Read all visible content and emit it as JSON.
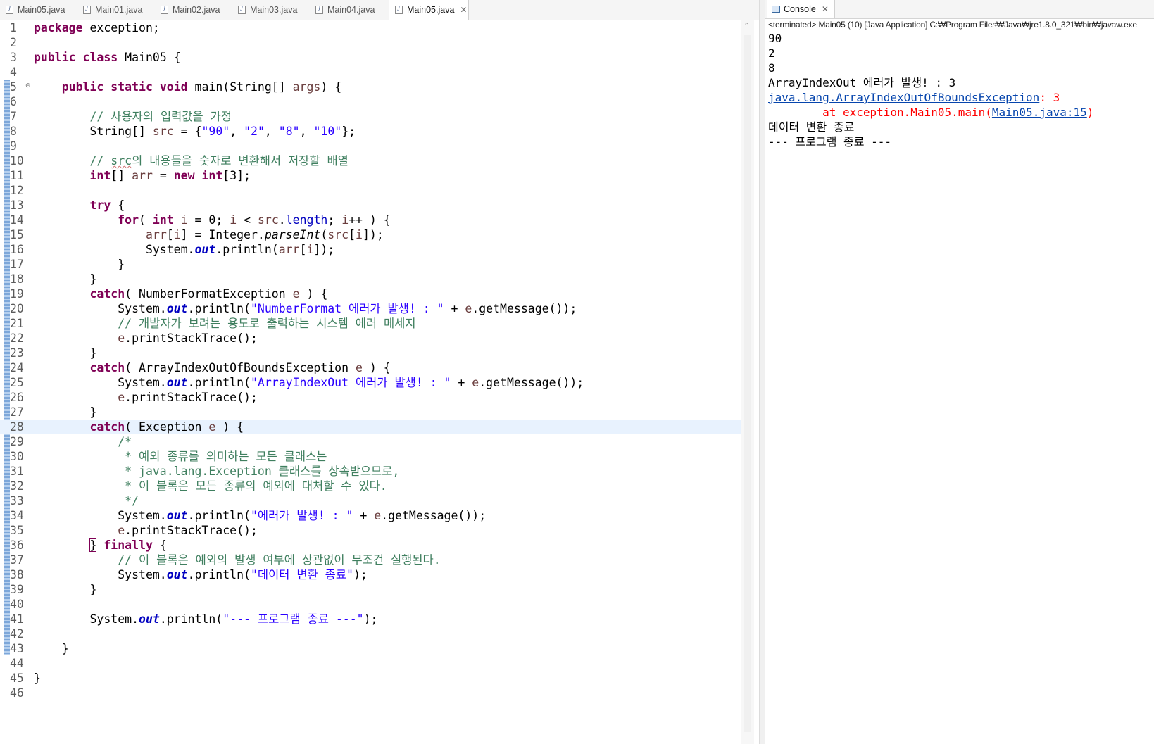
{
  "editor": {
    "tabs": [
      {
        "label": "Main05.java",
        "active": false
      },
      {
        "label": "Main01.java",
        "active": false
      },
      {
        "label": "Main02.java",
        "active": false
      },
      {
        "label": "Main03.java",
        "active": false
      },
      {
        "label": "Main04.java",
        "active": false
      },
      {
        "label": "Main05.java",
        "active": true
      }
    ],
    "close_icon": "close-icon",
    "current_line": 28,
    "lines": [
      [
        {
          "t": "package",
          "c": "kw"
        },
        {
          "t": " exception;"
        }
      ],
      [],
      [
        {
          "t": "public",
          "c": "kw"
        },
        {
          "t": " "
        },
        {
          "t": "class",
          "c": "kw"
        },
        {
          "t": " Main05 {"
        }
      ],
      [],
      [
        {
          "t": "    "
        },
        {
          "t": "public",
          "c": "kw"
        },
        {
          "t": " "
        },
        {
          "t": "static",
          "c": "kw"
        },
        {
          "t": " "
        },
        {
          "t": "void",
          "c": "kw"
        },
        {
          "t": " main(String[] "
        },
        {
          "t": "args",
          "c": "var"
        },
        {
          "t": ") {"
        }
      ],
      [],
      [
        {
          "t": "        "
        },
        {
          "t": "// 사용자의 입력값을 가정",
          "c": "cm"
        }
      ],
      [
        {
          "t": "        String[] "
        },
        {
          "t": "src",
          "c": "var"
        },
        {
          "t": " = {"
        },
        {
          "t": "\"90\"",
          "c": "str"
        },
        {
          "t": ", "
        },
        {
          "t": "\"2\"",
          "c": "str"
        },
        {
          "t": ", "
        },
        {
          "t": "\"8\"",
          "c": "str"
        },
        {
          "t": ", "
        },
        {
          "t": "\"10\"",
          "c": "str"
        },
        {
          "t": "};"
        }
      ],
      [],
      [
        {
          "t": "        "
        },
        {
          "t": "// ",
          "c": "cm"
        },
        {
          "t": "src",
          "c": "cm squig"
        },
        {
          "t": "의 내용들을 숫자로 변환해서 저장할 배열",
          "c": "cm"
        }
      ],
      [
        {
          "t": "        "
        },
        {
          "t": "int",
          "c": "kw"
        },
        {
          "t": "[] "
        },
        {
          "t": "arr",
          "c": "var"
        },
        {
          "t": " = "
        },
        {
          "t": "new",
          "c": "kw"
        },
        {
          "t": " "
        },
        {
          "t": "int",
          "c": "kw"
        },
        {
          "t": "[3];"
        }
      ],
      [],
      [
        {
          "t": "        "
        },
        {
          "t": "try",
          "c": "kw"
        },
        {
          "t": " {"
        }
      ],
      [
        {
          "t": "            "
        },
        {
          "t": "for",
          "c": "kw"
        },
        {
          "t": "( "
        },
        {
          "t": "int",
          "c": "kw"
        },
        {
          "t": " "
        },
        {
          "t": "i",
          "c": "var"
        },
        {
          "t": " = 0; "
        },
        {
          "t": "i",
          "c": "var"
        },
        {
          "t": " < "
        },
        {
          "t": "src",
          "c": "var"
        },
        {
          "t": "."
        },
        {
          "t": "length",
          "c": "fld"
        },
        {
          "t": "; "
        },
        {
          "t": "i",
          "c": "var"
        },
        {
          "t": "++ ) {"
        }
      ],
      [
        {
          "t": "                "
        },
        {
          "t": "arr",
          "c": "var"
        },
        {
          "t": "["
        },
        {
          "t": "i",
          "c": "var"
        },
        {
          "t": "] = Integer."
        },
        {
          "t": "parseInt",
          "c": "it"
        },
        {
          "t": "("
        },
        {
          "t": "src",
          "c": "var"
        },
        {
          "t": "["
        },
        {
          "t": "i",
          "c": "var"
        },
        {
          "t": "]);"
        }
      ],
      [
        {
          "t": "                System."
        },
        {
          "t": "out",
          "c": "sf"
        },
        {
          "t": ".println("
        },
        {
          "t": "arr",
          "c": "var"
        },
        {
          "t": "["
        },
        {
          "t": "i",
          "c": "var"
        },
        {
          "t": "]);"
        }
      ],
      [
        {
          "t": "            }"
        }
      ],
      [
        {
          "t": "        }"
        }
      ],
      [
        {
          "t": "        "
        },
        {
          "t": "catch",
          "c": "kw"
        },
        {
          "t": "( NumberFormatException "
        },
        {
          "t": "e",
          "c": "var"
        },
        {
          "t": " ) {"
        }
      ],
      [
        {
          "t": "            System."
        },
        {
          "t": "out",
          "c": "sf"
        },
        {
          "t": ".println("
        },
        {
          "t": "\"NumberFormat 에러가 발생! : \"",
          "c": "str"
        },
        {
          "t": " + "
        },
        {
          "t": "e",
          "c": "var"
        },
        {
          "t": ".getMessage());"
        }
      ],
      [
        {
          "t": "            "
        },
        {
          "t": "// 개발자가 보려는 용도로 출력하는 시스템 에러 메세지",
          "c": "cm"
        }
      ],
      [
        {
          "t": "            "
        },
        {
          "t": "e",
          "c": "var"
        },
        {
          "t": ".printStackTrace();"
        }
      ],
      [
        {
          "t": "        }"
        }
      ],
      [
        {
          "t": "        "
        },
        {
          "t": "catch",
          "c": "kw"
        },
        {
          "t": "( ArrayIndexOutOfBoundsException "
        },
        {
          "t": "e",
          "c": "var"
        },
        {
          "t": " ) {"
        }
      ],
      [
        {
          "t": "            System."
        },
        {
          "t": "out",
          "c": "sf"
        },
        {
          "t": ".println("
        },
        {
          "t": "\"ArrayIndexOut 에러가 발생! : \"",
          "c": "str"
        },
        {
          "t": " + "
        },
        {
          "t": "e",
          "c": "var"
        },
        {
          "t": ".getMessage());"
        }
      ],
      [
        {
          "t": "            "
        },
        {
          "t": "e",
          "c": "var"
        },
        {
          "t": ".printStackTrace();"
        }
      ],
      [
        {
          "t": "        }"
        }
      ],
      [
        {
          "t": "        "
        },
        {
          "t": "catch",
          "c": "kw"
        },
        {
          "t": "( Exception "
        },
        {
          "t": "e",
          "c": "var"
        },
        {
          "t": " ) {"
        }
      ],
      [
        {
          "t": "            "
        },
        {
          "t": "/*",
          "c": "cm"
        }
      ],
      [
        {
          "t": "             "
        },
        {
          "t": "* 예외 종류를 의미하는 모든 클래스는",
          "c": "cm"
        }
      ],
      [
        {
          "t": "             "
        },
        {
          "t": "* java.lang.Exception 클래스를 상속받으므로,",
          "c": "cm"
        }
      ],
      [
        {
          "t": "             "
        },
        {
          "t": "* 이 블록은 모든 종류의 예외에 대처할 수 있다.",
          "c": "cm"
        }
      ],
      [
        {
          "t": "             "
        },
        {
          "t": "*/",
          "c": "cm"
        }
      ],
      [
        {
          "t": "            System."
        },
        {
          "t": "out",
          "c": "sf"
        },
        {
          "t": ".println("
        },
        {
          "t": "\"에러가 발생! : \"",
          "c": "str"
        },
        {
          "t": " + "
        },
        {
          "t": "e",
          "c": "var"
        },
        {
          "t": ".getMessage());"
        }
      ],
      [
        {
          "t": "            "
        },
        {
          "t": "e",
          "c": "var"
        },
        {
          "t": ".printStackTrace();"
        }
      ],
      [
        {
          "t": "        "
        },
        {
          "t": "}",
          "c": "bracket"
        },
        {
          "t": " "
        },
        {
          "t": "finally",
          "c": "kw"
        },
        {
          "t": " {"
        }
      ],
      [
        {
          "t": "            "
        },
        {
          "t": "// 이 블록은 예외의 발생 여부에 상관없이 무조건 실행된다.",
          "c": "cm"
        }
      ],
      [
        {
          "t": "            System."
        },
        {
          "t": "out",
          "c": "sf"
        },
        {
          "t": ".println("
        },
        {
          "t": "\"데이터 변환 종료\"",
          "c": "str"
        },
        {
          "t": ");"
        }
      ],
      [
        {
          "t": "        }"
        }
      ],
      [],
      [
        {
          "t": "        System."
        },
        {
          "t": "out",
          "c": "sf"
        },
        {
          "t": ".println("
        },
        {
          "t": "\"--- 프로그램 종료 ---\"",
          "c": "str"
        },
        {
          "t": ");"
        }
      ],
      [],
      [
        {
          "t": "    }"
        }
      ],
      [],
      [
        {
          "t": "}"
        }
      ],
      []
    ]
  },
  "console": {
    "tab_label": "Console",
    "status": "<terminated> Main05 (10) [Java Application] C:₩Program Files₩Java₩jre1.8.0_321₩bin₩javaw.exe",
    "output": [
      [
        {
          "t": "90"
        }
      ],
      [
        {
          "t": "2"
        }
      ],
      [
        {
          "t": "8"
        }
      ],
      [
        {
          "t": "ArrayIndexOut 에러가 발생! : 3"
        }
      ],
      [
        {
          "t": "java.lang.ArrayIndexOutOfBoundsException",
          "c": "link"
        },
        {
          "t": ": 3",
          "c": "err"
        }
      ],
      [
        {
          "t": "\tat exception.Main05.main(",
          "c": "err"
        },
        {
          "t": "Main05.java:15",
          "c": "link"
        },
        {
          "t": ")",
          "c": "err"
        }
      ],
      [
        {
          "t": "데이터 변환 종료"
        }
      ],
      [
        {
          "t": "--- 프로그램 종료 ---"
        }
      ]
    ]
  }
}
